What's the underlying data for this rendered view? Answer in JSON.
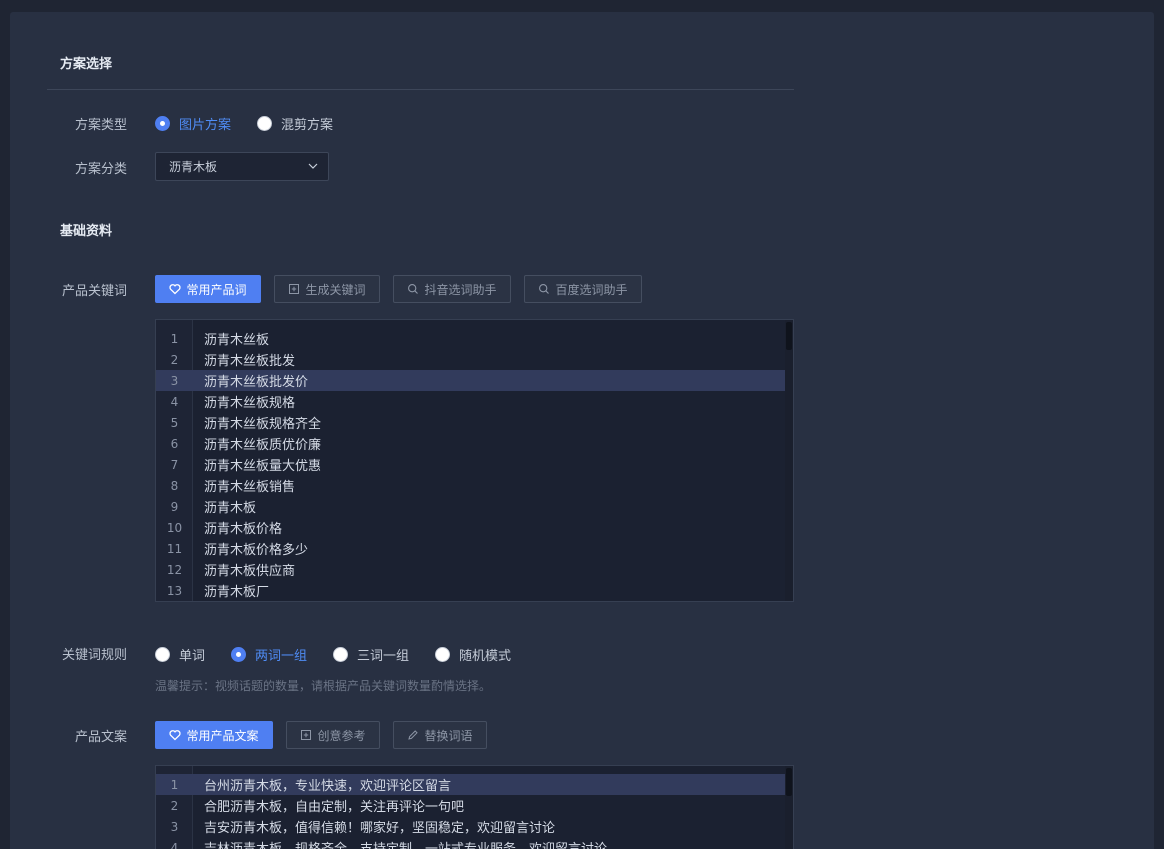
{
  "plan_section": {
    "title": "方案选择",
    "type_label": "方案类型",
    "type_options": [
      {
        "label": "图片方案",
        "checked": true
      },
      {
        "label": "混剪方案",
        "checked": false
      }
    ],
    "category_label": "方案分类",
    "category_value": "沥青木板"
  },
  "basic_section": {
    "title": "基础资料",
    "keyword_label": "产品关键词",
    "keyword_buttons": {
      "common": "常用产品词",
      "generate": "生成关键词",
      "douyin": "抖音选词助手",
      "baidu": "百度选词助手"
    },
    "keyword_lines": [
      {
        "num": "1",
        "text": "沥青木丝板"
      },
      {
        "num": "2",
        "text": "沥青木丝板批发"
      },
      {
        "num": "3",
        "text": "沥青木丝板批发价"
      },
      {
        "num": "4",
        "text": "沥青木丝板规格"
      },
      {
        "num": "5",
        "text": "沥青木丝板规格齐全"
      },
      {
        "num": "6",
        "text": "沥青木丝板质优价廉"
      },
      {
        "num": "7",
        "text": "沥青木丝板量大优惠"
      },
      {
        "num": "8",
        "text": "沥青木丝板销售"
      },
      {
        "num": "9",
        "text": "沥青木板"
      },
      {
        "num": "10",
        "text": "沥青木板价格"
      },
      {
        "num": "11",
        "text": "沥青木板价格多少"
      },
      {
        "num": "12",
        "text": "沥青木板供应商"
      },
      {
        "num": "13",
        "text": "沥青木板厂"
      }
    ],
    "keyword_active_line": 3,
    "rule_label": "关键词规则",
    "rule_options": [
      {
        "label": "单词",
        "checked": false
      },
      {
        "label": "两词一组",
        "checked": true
      },
      {
        "label": "三词一组",
        "checked": false
      },
      {
        "label": "随机模式",
        "checked": false
      }
    ],
    "rule_hint": "温馨提示：视频话题的数量，请根据产品关键词数量酌情选择。",
    "copy_label": "产品文案",
    "copy_buttons": {
      "common": "常用产品文案",
      "creative": "创意参考",
      "replace": "替换词语"
    },
    "copy_lines": [
      {
        "num": "1",
        "text": "台州沥青木板，专业快速，欢迎评论区留言"
      },
      {
        "num": "2",
        "text": "合肥沥青木板，自由定制，关注再评论一句吧"
      },
      {
        "num": "3",
        "text": "吉安沥青木板，值得信赖！哪家好，坚固稳定，欢迎留言讨论"
      },
      {
        "num": "4",
        "text": "吉林沥青木板，规格齐全，支持定制，一站式专业服务，欢迎留言讨论"
      }
    ],
    "copy_active_line": 1
  },
  "colors": {
    "accent": "#4f7ff2",
    "background": "#1f2533",
    "panel": "#283042"
  }
}
